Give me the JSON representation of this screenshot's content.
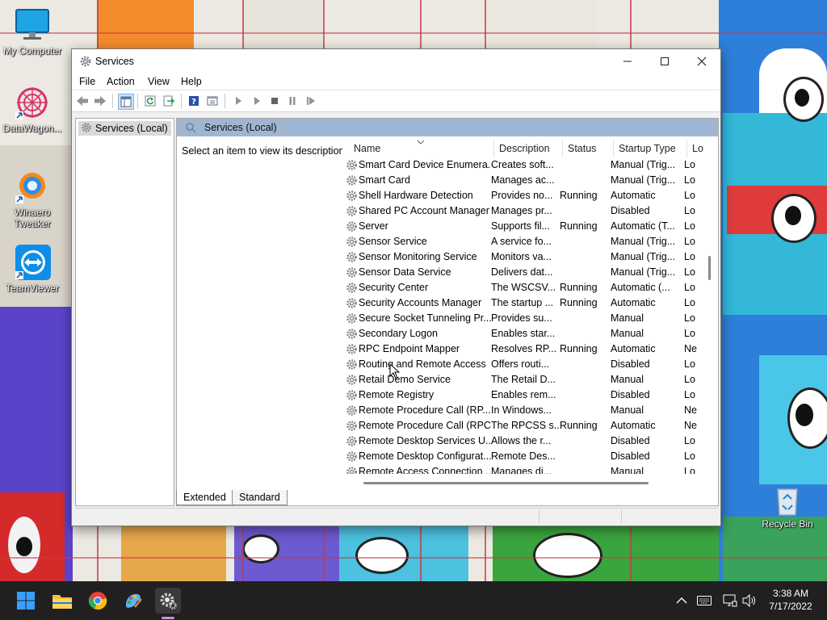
{
  "desktop": {
    "icons": [
      {
        "label": "My Computer"
      },
      {
        "label": "DataWagon..."
      },
      {
        "label": "Winaero Tweaker"
      },
      {
        "label": "TeamViewer"
      },
      {
        "label": "Recycle Bin"
      }
    ]
  },
  "window": {
    "title": "Services",
    "controls": {
      "minimize": "─",
      "maximize": "☐",
      "close": "✕"
    },
    "menu": [
      "File",
      "Action",
      "View",
      "Help"
    ],
    "tree": {
      "root": "Services (Local)"
    },
    "pane": {
      "header": "Services (Local)",
      "description_prompt": "Select an item to view its description."
    },
    "columns": [
      "Name",
      "Description",
      "Status",
      "Startup Type",
      "Lo"
    ],
    "services": [
      {
        "name": "Smart Card Device Enumera...",
        "description": "Creates soft...",
        "status": "",
        "startup": "Manual (Trig...",
        "logon": "Lo"
      },
      {
        "name": "Smart Card",
        "description": "Manages ac...",
        "status": "",
        "startup": "Manual (Trig...",
        "logon": "Lo"
      },
      {
        "name": "Shell Hardware Detection",
        "description": "Provides no...",
        "status": "Running",
        "startup": "Automatic",
        "logon": "Lo"
      },
      {
        "name": "Shared PC Account Manager",
        "description": "Manages pr...",
        "status": "",
        "startup": "Disabled",
        "logon": "Lo"
      },
      {
        "name": "Server",
        "description": "Supports fil...",
        "status": "Running",
        "startup": "Automatic (T...",
        "logon": "Lo"
      },
      {
        "name": "Sensor Service",
        "description": "A service fo...",
        "status": "",
        "startup": "Manual (Trig...",
        "logon": "Lo"
      },
      {
        "name": "Sensor Monitoring Service",
        "description": "Monitors va...",
        "status": "",
        "startup": "Manual (Trig...",
        "logon": "Lo"
      },
      {
        "name": "Sensor Data Service",
        "description": "Delivers dat...",
        "status": "",
        "startup": "Manual (Trig...",
        "logon": "Lo"
      },
      {
        "name": "Security Center",
        "description": "The WSCSV...",
        "status": "Running",
        "startup": "Automatic (...",
        "logon": "Lo"
      },
      {
        "name": "Security Accounts Manager",
        "description": "The startup ...",
        "status": "Running",
        "startup": "Automatic",
        "logon": "Lo"
      },
      {
        "name": "Secure Socket Tunneling Pr...",
        "description": "Provides su...",
        "status": "",
        "startup": "Manual",
        "logon": "Lo"
      },
      {
        "name": "Secondary Logon",
        "description": "Enables star...",
        "status": "",
        "startup": "Manual",
        "logon": "Lo"
      },
      {
        "name": "RPC Endpoint Mapper",
        "description": "Resolves RP...",
        "status": "Running",
        "startup": "Automatic",
        "logon": "Ne"
      },
      {
        "name": "Routing and Remote Access",
        "description": "Offers routi...",
        "status": "",
        "startup": "Disabled",
        "logon": "Lo"
      },
      {
        "name": "Retail Demo Service",
        "description": "The Retail D...",
        "status": "",
        "startup": "Manual",
        "logon": "Lo"
      },
      {
        "name": "Remote Registry",
        "description": "Enables rem...",
        "status": "",
        "startup": "Disabled",
        "logon": "Lo"
      },
      {
        "name": "Remote Procedure Call (RP...",
        "description": "In Windows...",
        "status": "",
        "startup": "Manual",
        "logon": "Ne"
      },
      {
        "name": "Remote Procedure Call (RPC)",
        "description": "The RPCSS s...",
        "status": "Running",
        "startup": "Automatic",
        "logon": "Ne"
      },
      {
        "name": "Remote Desktop Services U...",
        "description": "Allows the r...",
        "status": "",
        "startup": "Disabled",
        "logon": "Lo"
      },
      {
        "name": "Remote Desktop Configurat...",
        "description": "Remote Des...",
        "status": "",
        "startup": "Disabled",
        "logon": "Lo"
      },
      {
        "name": "Remote Access Connection ...",
        "description": "Manages di...",
        "status": "",
        "startup": "Manual",
        "logon": "Lo"
      }
    ],
    "tabs": [
      "Extended",
      "Standard"
    ]
  },
  "taskbar": {
    "time": "3:38 AM",
    "date": "7/17/2022"
  },
  "colors": {
    "header_band": "#9fb6d2",
    "taskbar": "#202020",
    "accent": "#0a72d6"
  }
}
